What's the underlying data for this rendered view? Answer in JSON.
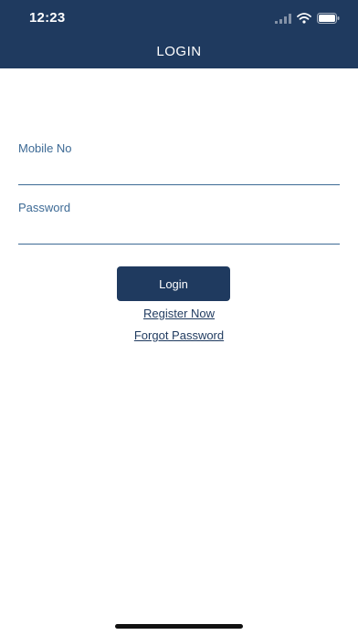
{
  "status_bar": {
    "time": "12:23",
    "icons": [
      "signal-icon",
      "wifi-icon",
      "battery-icon"
    ]
  },
  "header": {
    "title": "LOGIN"
  },
  "form": {
    "mobile": {
      "label": "Mobile No",
      "value": "",
      "placeholder": ""
    },
    "password": {
      "label": "Password",
      "value": "",
      "placeholder": ""
    },
    "login_label": "Login"
  },
  "links": {
    "register": "Register Now",
    "forgot_password": "Forgot Password"
  },
  "colors": {
    "primary": "#1f3a5f",
    "label": "#3d6a95",
    "background": "#ffffff"
  }
}
